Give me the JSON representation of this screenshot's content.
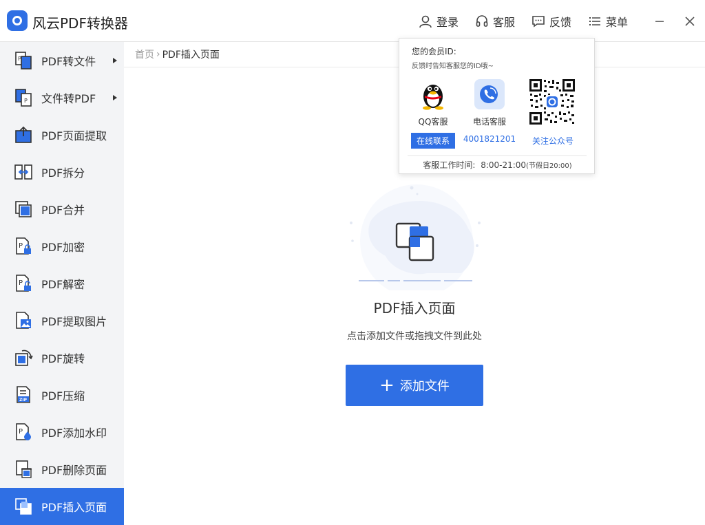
{
  "app": {
    "title": "风云PDF转换器",
    "accent": "#2f6fe4"
  },
  "header": {
    "login_label": "登录",
    "service_label": "客服",
    "feedback_label": "反馈",
    "menu_label": "菜单"
  },
  "sidebar": {
    "items": [
      {
        "label": "PDF转文件",
        "icon": "pdf-to-file-icon",
        "has_submenu": true
      },
      {
        "label": "文件转PDF",
        "icon": "file-to-pdf-icon",
        "has_submenu": true
      },
      {
        "label": "PDF页面提取",
        "icon": "page-extract-icon"
      },
      {
        "label": "PDF拆分",
        "icon": "split-icon"
      },
      {
        "label": "PDF合并",
        "icon": "merge-icon"
      },
      {
        "label": "PDF加密",
        "icon": "lock-icon"
      },
      {
        "label": "PDF解密",
        "icon": "unlock-icon"
      },
      {
        "label": "PDF提取图片",
        "icon": "image-extract-icon"
      },
      {
        "label": "PDF旋转",
        "icon": "rotate-icon"
      },
      {
        "label": "PDF压缩",
        "icon": "zip-icon"
      },
      {
        "label": "PDF添加水印",
        "icon": "watermark-icon"
      },
      {
        "label": "PDF删除页面",
        "icon": "delete-page-icon"
      },
      {
        "label": "PDF插入页面",
        "icon": "insert-page-icon",
        "active": true
      }
    ]
  },
  "breadcrumb": {
    "home": "首页",
    "separator": "›",
    "current": "PDF插入页面"
  },
  "main": {
    "title": "PDF插入页面",
    "hint": "点击添加文件或拖拽文件到此处",
    "add_button_label": "添加文件"
  },
  "popup": {
    "member_id_label": "您的会员ID:",
    "tip": "反馈时告知客服您的ID哦~",
    "qq_label": "QQ客服",
    "phone_label": "电话客服",
    "online_button": "在线联系",
    "phone_number": "4001821201",
    "follow_label": "关注公众号",
    "hours_label": "客服工作时间:",
    "hours": "8:00-21:00",
    "holiday_hours": "(节假日20:00)"
  }
}
